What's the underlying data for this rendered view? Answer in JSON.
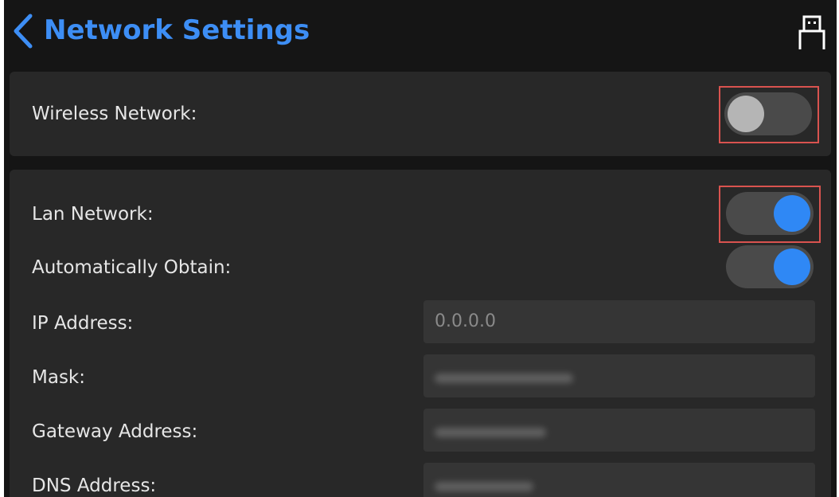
{
  "header": {
    "title": "Network Settings",
    "back_icon": "chevron-left-icon",
    "right_icon": "usb-icon",
    "accent_color": "#3d8ef5"
  },
  "wireless": {
    "label": "Wireless Network:",
    "enabled": false
  },
  "lan": {
    "label": "Lan Network:",
    "enabled": true,
    "auto_obtain": {
      "label": "Automatically Obtain:",
      "enabled": true
    },
    "ip": {
      "label": "IP Address:",
      "value": "0.0.0.0"
    },
    "mask": {
      "label": "Mask:"
    },
    "gateway": {
      "label": "Gateway Address:"
    },
    "dns": {
      "label": "DNS Address:"
    }
  },
  "colors": {
    "toggle_on": "#2f88f5",
    "toggle_off_knob": "#b5b5b5",
    "highlight_box": "#d9534f"
  }
}
